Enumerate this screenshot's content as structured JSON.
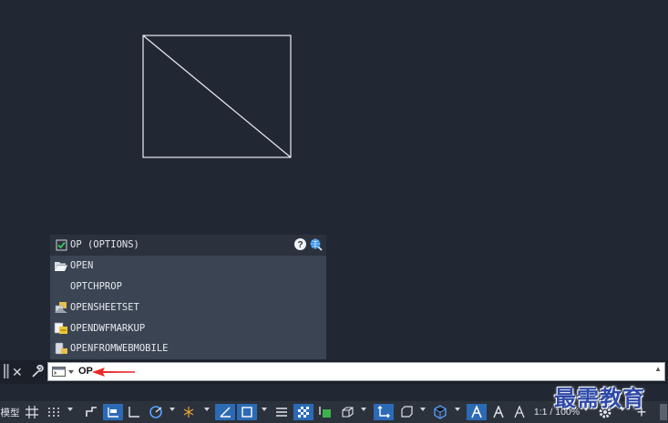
{
  "autocomplete": {
    "items": [
      {
        "label": "OP (OPTIONS)",
        "icon": "checkbox-icon"
      },
      {
        "label": "OPEN",
        "icon": "folder-open-icon"
      },
      {
        "label": "OPTCHPROP",
        "icon": ""
      },
      {
        "label": "OPENSHEETSET",
        "icon": "sheet-set-icon"
      },
      {
        "label": "OPENDWFMARKUP",
        "icon": "dwf-markup-icon"
      },
      {
        "label": "OPENFROMWEBMOBILE",
        "icon": "web-mobile-icon"
      }
    ]
  },
  "command_line": {
    "input_value": "OP"
  },
  "status_bar": {
    "model_label": "模型",
    "scale_label": "1:1 / 100%"
  },
  "watermark": {
    "text": "最需教育"
  },
  "colors": {
    "background": "#222833",
    "accent": "#2c6ab5",
    "arrow": "#e8282a"
  }
}
